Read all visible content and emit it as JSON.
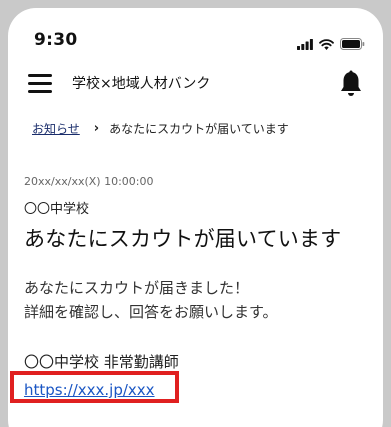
{
  "status_bar": {
    "time": "9:30"
  },
  "header": {
    "app_title": "学校×地域人材バンク"
  },
  "breadcrumb": {
    "parent": "お知らせ",
    "separator": "›",
    "current": "あなたにスカウトが届いています"
  },
  "message": {
    "date": "20xx/xx/xx(X) 10:00:00",
    "sender": "〇〇中学校",
    "title": "あなたにスカウトが届いています",
    "body_lines": [
      "あなたにスカウトが届きました！",
      "詳細を確認し、回答をお願いします。"
    ],
    "signature_name": "〇〇中学校 非常勤講師",
    "signature_link": "https://xxx.jp/xxx"
  },
  "icons": {
    "menu": "hamburger-menu-icon",
    "notification": "bell-icon",
    "signal": "signal-icon",
    "wifi": "wifi-icon",
    "battery": "battery-icon"
  },
  "colors": {
    "link": "#1a56c4",
    "breadcrumb_link": "#1a2d6b",
    "highlight_border": "#e02020"
  }
}
